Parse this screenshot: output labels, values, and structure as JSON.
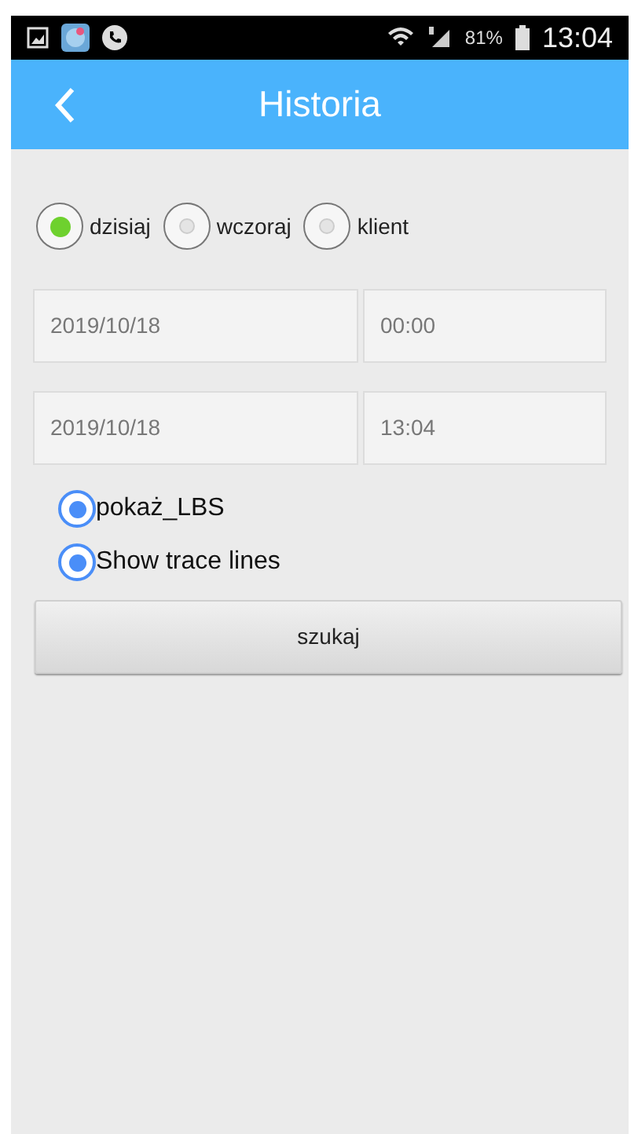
{
  "status_bar": {
    "battery_percent": "81%",
    "time": "13:04"
  },
  "app_bar": {
    "title": "Historia"
  },
  "range_options": [
    {
      "label": "dzisiaj",
      "selected": true
    },
    {
      "label": "wczoraj",
      "selected": false
    },
    {
      "label": "klient",
      "selected": false
    }
  ],
  "start": {
    "date": "2019/10/18",
    "time": "00:00"
  },
  "end": {
    "date": "2019/10/18",
    "time": "13:04"
  },
  "options": [
    {
      "label": "pokaż_LBS",
      "checked": true
    },
    {
      "label": "Show trace lines",
      "checked": true
    }
  ],
  "search_button": "szukaj"
}
